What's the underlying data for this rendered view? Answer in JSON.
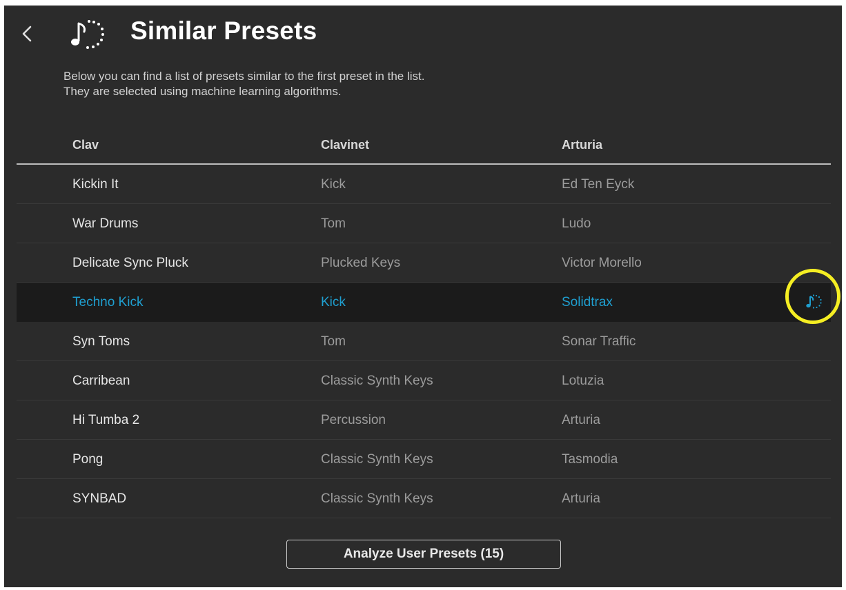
{
  "header": {
    "title": "Similar Presets",
    "back_icon": "chevron-left-icon",
    "title_icon": "similar-sound-icon"
  },
  "description": {
    "line1": "Below you can find a list of presets similar to the first preset in the list.",
    "line2": "They are selected using machine learning algorithms."
  },
  "table": {
    "header": {
      "name": "Clav",
      "type": "Clavinet",
      "designer": "Arturia"
    },
    "rows": [
      {
        "name": "Kickin It",
        "type": "Kick",
        "designer": "Ed Ten Eyck"
      },
      {
        "name": "War Drums",
        "type": "Tom",
        "designer": "Ludo"
      },
      {
        "name": "Delicate Sync Pluck",
        "type": "Plucked Keys",
        "designer": "Victor Morello"
      },
      {
        "name": "Techno Kick",
        "type": "Kick",
        "designer": "Solidtrax",
        "selected": true,
        "row_icon": "similar-sound-icon"
      },
      {
        "name": "Syn Toms",
        "type": "Tom",
        "designer": "Sonar Traffic"
      },
      {
        "name": "Carribean",
        "type": "Classic Synth Keys",
        "designer": "Lotuzia"
      },
      {
        "name": "Hi Tumba 2",
        "type": "Percussion",
        "designer": "Arturia"
      },
      {
        "name": "Pong",
        "type": "Classic Synth Keys",
        "designer": "Tasmodia"
      },
      {
        "name": "SYNBAD",
        "type": "Classic Synth Keys",
        "designer": "Arturia"
      }
    ]
  },
  "footer": {
    "analyze_button_label": "Analyze User Presets (15)"
  },
  "colors": {
    "panel_background": "#2b2b2b",
    "selected_row_background": "#1b1b1b",
    "accent": "#1f9fd0",
    "highlight_ring": "#f5ee23"
  }
}
